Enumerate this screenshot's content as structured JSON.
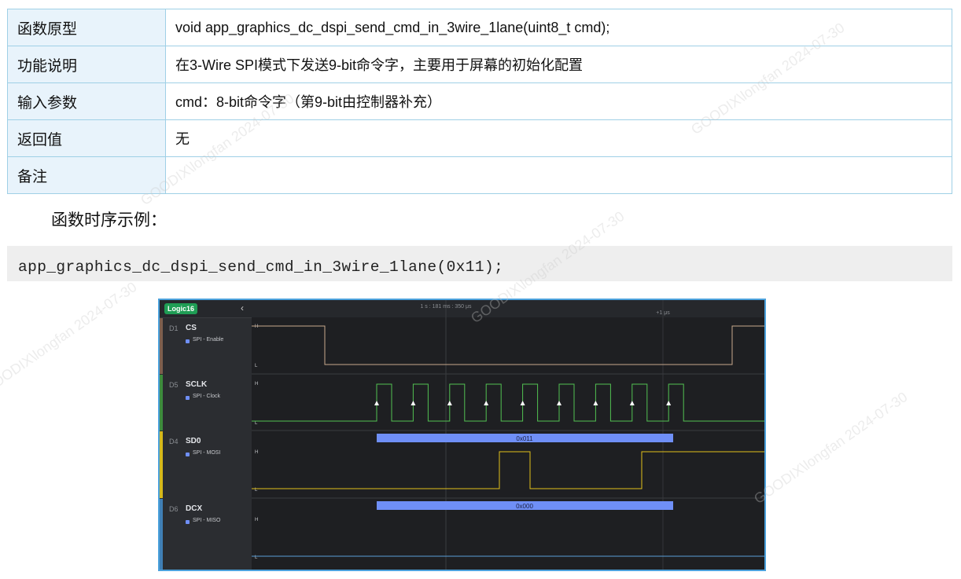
{
  "spec": {
    "rows": [
      {
        "key": "函数原型",
        "value": "void app_graphics_dc_dspi_send_cmd_in_3wire_1lane(uint8_t cmd);"
      },
      {
        "key": "功能说明",
        "value": "在3-Wire SPI模式下发送9-bit命令字，主要用于屏幕的初始化配置"
      },
      {
        "key": "输入参数",
        "value": "cmd：8-bit命令字（第9-bit由控制器补充）"
      },
      {
        "key": "返回值",
        "value": "无"
      },
      {
        "key": "备注",
        "value": ""
      }
    ]
  },
  "section_heading": "函数时序示例：",
  "code": "app_graphics_dc_dspi_send_cmd_in_3wire_1lane(0x11);",
  "analyzer": {
    "device": "Logic16",
    "time_label": "1 s : 181 ms : 350 μs",
    "delta_label": "+1 μs",
    "level_high": "H",
    "level_low": "L",
    "channels": [
      {
        "id": "D1",
        "name": "CS",
        "sub": "SPI - Enable",
        "color": "#c8a88c"
      },
      {
        "id": "D5",
        "name": "SCLK",
        "sub": "SPI - Clock",
        "color": "#52c152"
      },
      {
        "id": "D4",
        "name": "SD0",
        "sub": "SPI - MOSI",
        "color": "#e2c21a"
      },
      {
        "id": "D6",
        "name": "DCX",
        "sub": "SPI - MISO",
        "color": "#5a9fd8"
      }
    ],
    "mosi_value": "0x011",
    "miso_value": "0x000",
    "clock_edges": 9
  },
  "watermark": "GOODIX\\longfan 2024-07-30"
}
